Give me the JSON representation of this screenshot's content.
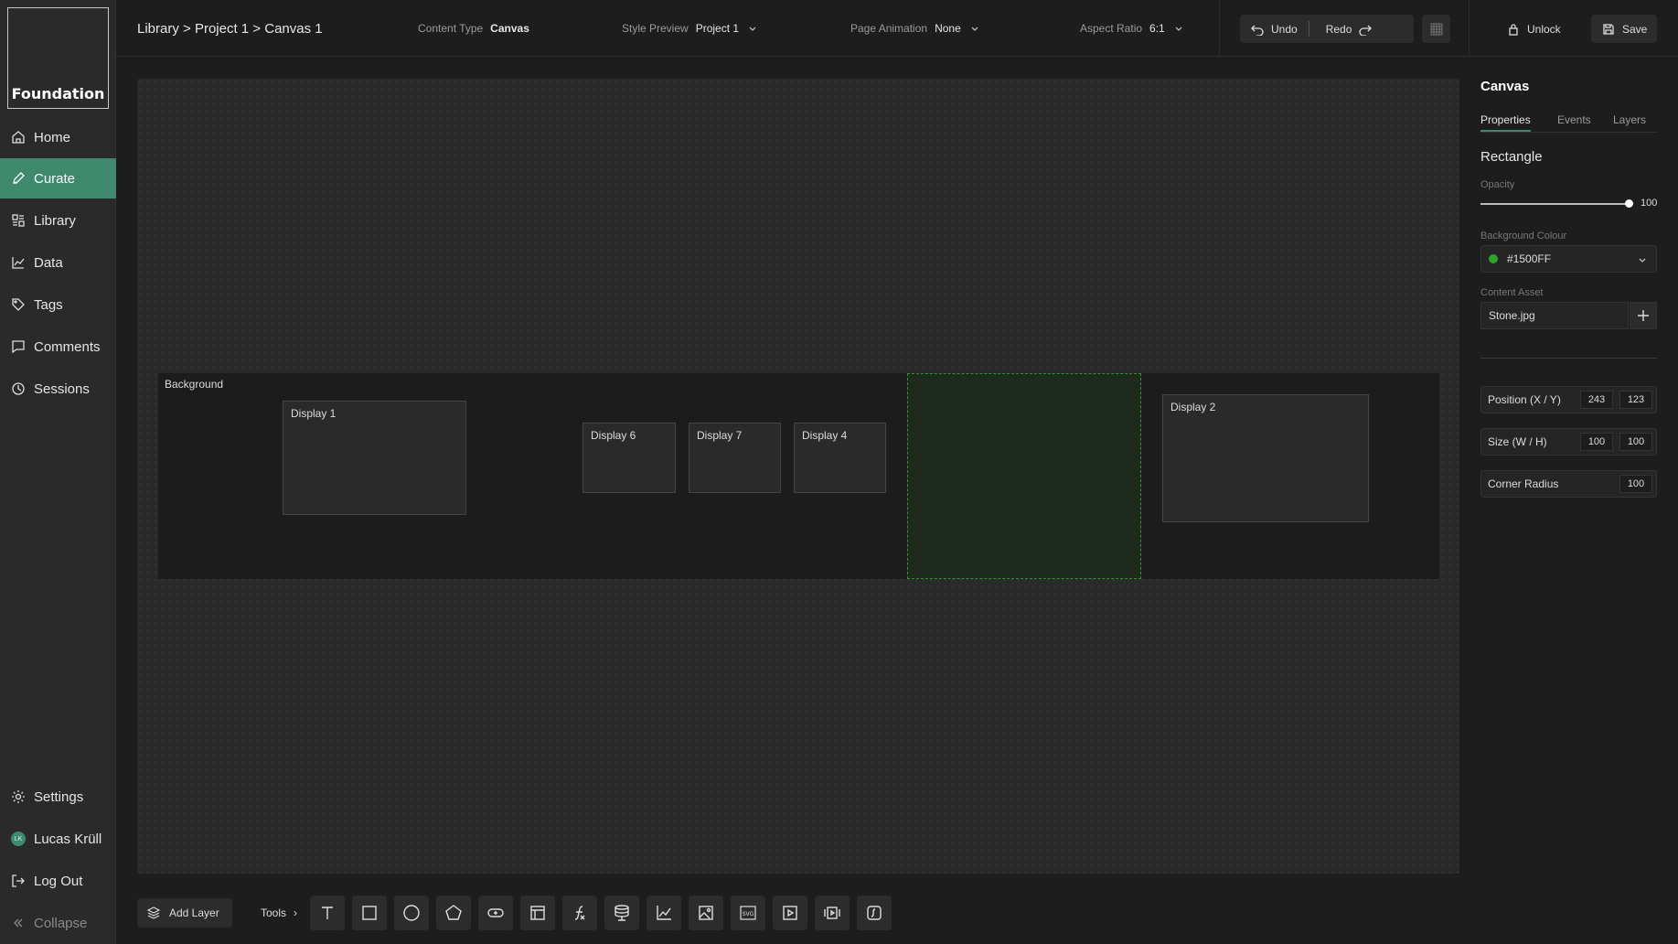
{
  "sidebar": {
    "logo": "Foundation",
    "items": [
      {
        "label": "Home",
        "icon": "home-icon"
      },
      {
        "label": "Curate",
        "icon": "pencil-icon",
        "active": true
      },
      {
        "label": "Library",
        "icon": "library-icon"
      },
      {
        "label": "Data",
        "icon": "chart-icon"
      },
      {
        "label": "Tags",
        "icon": "tag-icon"
      },
      {
        "label": "Comments",
        "icon": "comment-icon"
      },
      {
        "label": "Sessions",
        "icon": "clock-icon"
      }
    ],
    "bottom": {
      "settings": "Settings",
      "user": "Lucas Krüll",
      "user_initials": "LK",
      "logout": "Log Out",
      "collapse": "Collapse"
    }
  },
  "topbar": {
    "breadcrumb": "Library > Project 1 > Canvas 1",
    "content_type_label": "Content Type",
    "content_type_value": "Canvas",
    "style_preview_label": "Style Preview",
    "style_preview_value": "Project 1",
    "page_animation_label": "Page Animation",
    "page_animation_value": "None",
    "aspect_ratio_label": "Aspect Ratio",
    "aspect_ratio_value": "6:1",
    "undo": "Undo",
    "redo": "Redo",
    "unlock": "Unlock",
    "save": "Save"
  },
  "canvas": {
    "background_label": "Background",
    "displays": {
      "d1": "Display 1",
      "d6": "Display 6",
      "d7": "Display 7",
      "d4": "Display 4",
      "d2": "Display 2"
    }
  },
  "bottombar": {
    "add_layer": "Add Layer",
    "tools": "Tools",
    "tool_icons": [
      "text-icon",
      "rectangle-icon",
      "circle-icon",
      "polygon-icon",
      "button-icon",
      "layout-icon",
      "function-icon",
      "database-icon",
      "chart-icon",
      "image-icon",
      "svg-icon",
      "video-icon",
      "slideshow-icon",
      "embed-icon"
    ]
  },
  "panel": {
    "title": "Canvas",
    "tabs": [
      "Properties",
      "Events",
      "Layers"
    ],
    "section": "Rectangle",
    "opacity_label": "Opacity",
    "opacity_value": "100",
    "bg_colour_label": "Background Colour",
    "bg_colour_value": "#1500FF",
    "swatch_color": "#2ea32e",
    "content_asset_label": "Content Asset",
    "content_asset_value": "Stone.jpg",
    "position_label": "Position (X / Y)",
    "position_x": "243",
    "position_y": "123",
    "size_label": "Size (W / H)",
    "size_w": "100",
    "size_h": "100",
    "corner_label": "Corner Radius",
    "corner_value": "100"
  },
  "colors": {
    "accent": "#3f8a6e",
    "selection": "#3c8a3c"
  }
}
